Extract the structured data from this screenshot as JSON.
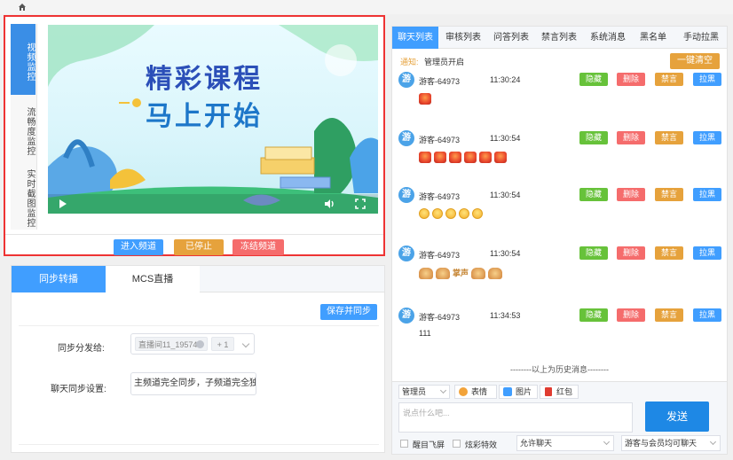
{
  "video": {
    "tabs": [
      {
        "label": "视频监控"
      },
      {
        "label": "流畅度监控"
      },
      {
        "label": "实时截图监控"
      }
    ],
    "poster_line1": "精彩课程",
    "poster_line2": "马上开始",
    "buttons": {
      "enter": "进入频道",
      "stop": "已停止",
      "freeze": "冻结频道"
    }
  },
  "sync": {
    "tabs": {
      "sync": "同步转播",
      "mcs": "MCS直播"
    },
    "save_label": "保存并同步",
    "distribute_label": "同步分发给:",
    "distribute_tag": "直播间11_19574",
    "distribute_more": "+ 1",
    "chat_sync_label": "聊天同步设置:",
    "chat_sync_value": "主频道完全同步，子频道完全独立"
  },
  "chat": {
    "tabs": [
      {
        "label": "聊天列表"
      },
      {
        "label": "审核列表"
      },
      {
        "label": "问答列表"
      },
      {
        "label": "禁言列表"
      },
      {
        "label": "系统消息"
      },
      {
        "label": "黑名单"
      },
      {
        "label": "手动拉黑"
      }
    ],
    "notice_label": "通知:",
    "notice_text": "管理员开启",
    "clear_label": "一键清空",
    "avatar_text": "游",
    "actions": {
      "hide": "隐藏",
      "delete": "删除",
      "mute": "禁言",
      "block": "拉黑"
    },
    "messages": [
      {
        "user": "游客-64973",
        "time": "11:30:24",
        "kind": "gift",
        "count": 1,
        "text": ""
      },
      {
        "user": "游客-64973",
        "time": "11:30:54",
        "kind": "gift",
        "count": 6,
        "text": ""
      },
      {
        "user": "游客-64973",
        "time": "11:30:54",
        "kind": "face",
        "count": 5,
        "text": ""
      },
      {
        "user": "游客-64973",
        "time": "11:30:54",
        "kind": "clap",
        "count": 4,
        "text": "掌声"
      },
      {
        "user": "游客-64973",
        "time": "11:34:53",
        "kind": "text",
        "count": 0,
        "text": "111"
      }
    ],
    "history_text": "--------以上为历史消息--------",
    "composer": {
      "role": "管理员",
      "emoji_label": "表情",
      "image_label": "图片",
      "redpack_label": "红包",
      "placeholder": "说点什么吧...",
      "send_label": "发送",
      "check1": "醒目飞屏",
      "check2": "炫彩特效",
      "select1": "允许聊天",
      "select2": "游客与会员均可聊天"
    }
  },
  "colors": {
    "primary": "#409eff",
    "success": "#67c23a",
    "danger": "#f56c6c",
    "warning": "#e6a23c",
    "highlight_border": "#ee3333"
  }
}
